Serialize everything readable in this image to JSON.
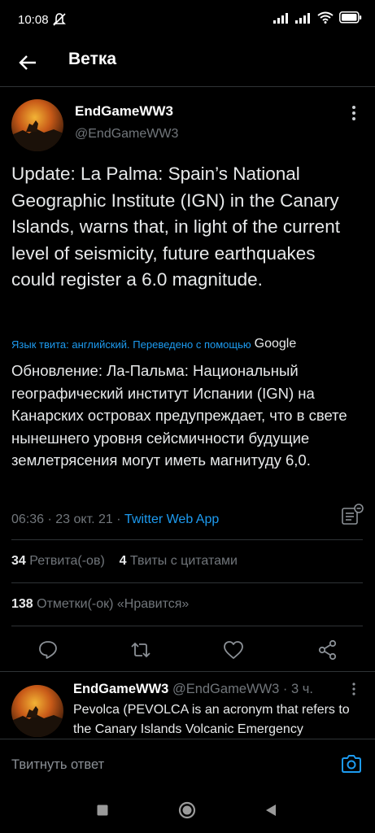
{
  "status": {
    "time": "10:08"
  },
  "header": {
    "title": "Ветка"
  },
  "tweet": {
    "name": "EndGameWW3",
    "handle": "@EndGameWW3",
    "text": "Update: La Palma: Spain’s National Geographic Institute (IGN) in the Canary Islands, warns that, in light of the current level of seismicity, future earthquakes could register a 6.0 magnitude.",
    "translate_label": "Язык твита: английский. Переведено с помощью",
    "translate_brand": "Google",
    "translated_text": "Обновление: Ла-Пальма: Национальный географический институт Испании (IGN) на Канарских островах предупреждает, что в свете нынешнего уровня сейсмичности будущие землетрясения могут иметь магнитуду 6,0.",
    "time": "06:36",
    "sep1": " · ",
    "date": "23 окт. 21",
    "sep2": " · ",
    "app": "Twitter Web App",
    "retweets_count": "34",
    "retweets_label": "Ретвита(-ов)",
    "quotes_count": "4",
    "quotes_label": "Твиты с цитатами",
    "likes_count": "138",
    "likes_label": "Отметки(-ок) «Нравится»"
  },
  "reply": {
    "name": "EndGameWW3",
    "handle": "@EndGameWW3",
    "time": "· 3 ч.",
    "text": "Pevolca (PEVOLCA is an acronym that refers to the Canary Islands Volcanic Emergency"
  },
  "compose": {
    "placeholder": "Твитнуть ответ"
  },
  "colors": {
    "accent": "#1d9bf0",
    "muted": "#71767b",
    "divider": "#2f3336",
    "background": "#000000"
  }
}
